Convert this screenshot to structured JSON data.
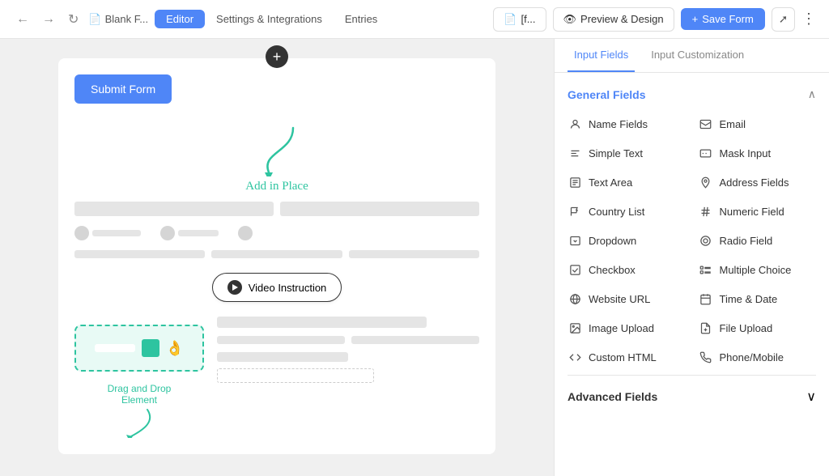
{
  "topbar": {
    "back_icon": "←",
    "forward_icon": "→",
    "reload_icon": "↺",
    "file_name": "Blank F...",
    "tabs": [
      {
        "label": "Editor",
        "active": true
      },
      {
        "label": "Settings & Integrations",
        "active": false
      },
      {
        "label": "Entries",
        "active": false
      }
    ],
    "breadcrumb_icon": "📄",
    "shortcut_label": "[f...",
    "preview_icon": "👁",
    "preview_label": "Preview & Design",
    "save_icon": "+",
    "save_label": "Save Form",
    "expand_icon": "⤢",
    "more_icon": "⋮"
  },
  "editor": {
    "add_button": "+",
    "submit_label": "Submit Form",
    "add_in_place_label": "Add in Place",
    "video_button_label": "Video Instruction",
    "drag_label": "Drag and Drop\nElement"
  },
  "panel": {
    "tabs": [
      {
        "label": "Input Fields",
        "active": true
      },
      {
        "label": "Input Customization",
        "active": false
      }
    ],
    "general_section_title": "General Fields",
    "fields": [
      {
        "icon": "👤",
        "label": "Name Fields",
        "col": 0
      },
      {
        "icon": "✉",
        "label": "Email",
        "col": 1
      },
      {
        "icon": "T",
        "label": "Simple Text",
        "col": 0
      },
      {
        "icon": "▤",
        "label": "Mask Input",
        "col": 1
      },
      {
        "icon": "☰",
        "label": "Text Area",
        "col": 0
      },
      {
        "icon": "📍",
        "label": "Address Fields",
        "col": 1
      },
      {
        "icon": "🏳",
        "label": "Country List",
        "col": 0
      },
      {
        "icon": "#",
        "label": "Numeric Field",
        "col": 1
      },
      {
        "icon": "▾",
        "label": "Dropdown",
        "col": 0
      },
      {
        "icon": "◎",
        "label": "Radio Field",
        "col": 1
      },
      {
        "icon": "☑",
        "label": "Checkbox",
        "col": 0
      },
      {
        "icon": "≡",
        "label": "Multiple Choice",
        "col": 1
      },
      {
        "icon": "◇",
        "label": "Website URL",
        "col": 0
      },
      {
        "icon": "📅",
        "label": "Time & Date",
        "col": 1
      },
      {
        "icon": "🖼",
        "label": "Image Upload",
        "col": 0
      },
      {
        "icon": "📁",
        "label": "File Upload",
        "col": 1
      },
      {
        "icon": "</>",
        "label": "Custom HTML",
        "col": 0
      },
      {
        "icon": "📱",
        "label": "Phone/Mobile",
        "col": 1
      }
    ],
    "advanced_section_title": "Advanced Fields",
    "advanced_chevron": "∨"
  }
}
